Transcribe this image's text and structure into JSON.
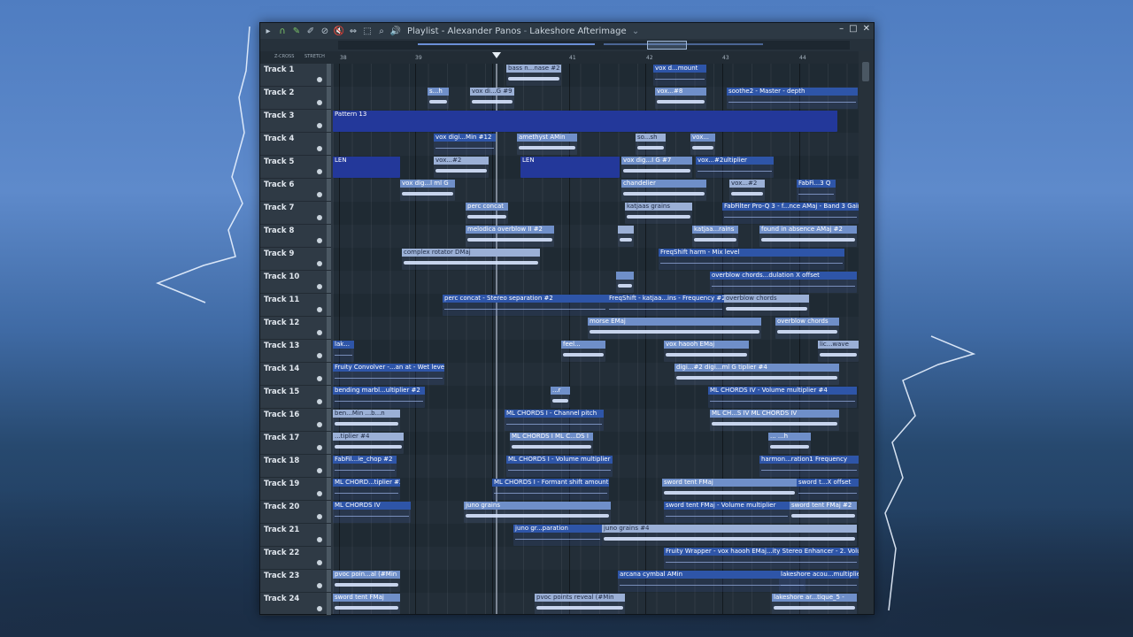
{
  "window": {
    "title_prefix": "Playlist",
    "title_sep": " - ",
    "artist": "Alexander Panos",
    "project": "Lakeshore Afterimage",
    "title_dash": "-",
    "dropdown_glyph": "⌄"
  },
  "toolbar": {
    "play": "▸",
    "magnet": "∩",
    "pencil": "✎",
    "brush": "✐",
    "delete": "⊘",
    "mute": "🔇",
    "slip": "⇔",
    "select": "⬚",
    "zoom": "⌕",
    "speaker": "🔊",
    "minimize": "–",
    "maximize": "□",
    "close": "✕"
  },
  "subtoolbar": {
    "zcross": "Z-CROSS",
    "stretch": "STRETCH"
  },
  "ruler": [
    "38",
    "39",
    "41",
    "42",
    "43",
    "44"
  ],
  "tracks": [
    "Track 1",
    "Track 2",
    "Track 3",
    "Track 4",
    "Track 5",
    "Track 6",
    "Track 7",
    "Track 8",
    "Track 9",
    "Track 10",
    "Track 11",
    "Track 12",
    "Track 13",
    "Track 14",
    "Track 15",
    "Track 16",
    "Track 17",
    "Track 18",
    "Track 19",
    "Track 20",
    "Track 21",
    "Track 22",
    "Track 23",
    "Track 24"
  ],
  "clips": [
    {
      "t": 0,
      "l": 196,
      "w": 62,
      "label": "bass n...nase #2",
      "k": "audio"
    },
    {
      "t": 0,
      "l": 362,
      "w": 60,
      "label": "vox d...mount",
      "k": "auto"
    },
    {
      "t": 1,
      "l": 107,
      "w": 24,
      "label": "s...h",
      "k": "audio"
    },
    {
      "t": 1,
      "l": 155,
      "w": 50,
      "label": "vox di...G #9",
      "k": "audio"
    },
    {
      "t": 1,
      "l": 364,
      "w": 58,
      "label": "vox...#8",
      "k": "audio"
    },
    {
      "t": 1,
      "l": 445,
      "w": 148,
      "label": "soothe2 - Master - depth",
      "k": "auto"
    },
    {
      "t": 2,
      "l": 0,
      "w": 570,
      "label": "Pattern 13",
      "k": "pattern"
    },
    {
      "t": 3,
      "l": 114,
      "w": 70,
      "label": "vox digi...Min #12",
      "k": "auto"
    },
    {
      "t": 3,
      "l": 208,
      "w": 68,
      "label": "amethyst AMin",
      "k": "audio"
    },
    {
      "t": 3,
      "l": 342,
      "w": 34,
      "label": "so...sh",
      "k": "audio"
    },
    {
      "t": 3,
      "l": 404,
      "w": 28,
      "label": "vox...",
      "k": "audio"
    },
    {
      "t": 4,
      "l": 0,
      "w": 76,
      "label": "LEN",
      "k": "pattern"
    },
    {
      "t": 4,
      "l": 114,
      "w": 62,
      "label": "vox...#2",
      "k": "audio"
    },
    {
      "t": 4,
      "l": 212,
      "w": 112,
      "label": "LEN",
      "k": "pattern"
    },
    {
      "t": 4,
      "l": 326,
      "w": 80,
      "label": "vox dig...I G #7",
      "k": "audio"
    },
    {
      "t": 4,
      "l": 410,
      "w": 88,
      "label": "vox...#2ultiplier",
      "k": "auto"
    },
    {
      "t": 5,
      "l": 76,
      "w": 62,
      "label": "vox dig...l ml G",
      "k": "audio"
    },
    {
      "t": 5,
      "l": 326,
      "w": 96,
      "label": "chandelier",
      "k": "audio"
    },
    {
      "t": 5,
      "l": 448,
      "w": 40,
      "label": "vox...#2",
      "k": "audio"
    },
    {
      "t": 5,
      "l": 524,
      "w": 44,
      "label": "FabFi...3 Q",
      "k": "auto"
    },
    {
      "t": 6,
      "l": 150,
      "w": 48,
      "label": "perc concat",
      "k": "audio"
    },
    {
      "t": 6,
      "l": 330,
      "w": 76,
      "label": "katjaas grains",
      "k": "audio"
    },
    {
      "t": 6,
      "l": 440,
      "w": 154,
      "label": "FabFilter Pro-Q 3 - f...nce AMaj - Band 3 Gain",
      "k": "auto"
    },
    {
      "t": 7,
      "l": 150,
      "w": 100,
      "label": "melodica overblow II #2",
      "k": "audio"
    },
    {
      "t": 7,
      "l": 322,
      "w": 18,
      "label": "",
      "k": "audio"
    },
    {
      "t": 7,
      "l": 406,
      "w": 52,
      "label": "katjaa...rains",
      "k": "audio"
    },
    {
      "t": 7,
      "l": 482,
      "w": 110,
      "label": "found in absence AMaj #2",
      "k": "audio"
    },
    {
      "t": 8,
      "l": 78,
      "w": 156,
      "label": "complex rotator DMaj",
      "k": "audio"
    },
    {
      "t": 8,
      "l": 368,
      "w": 210,
      "label": "FreqShift harm - Mix level",
      "k": "auto"
    },
    {
      "t": 9,
      "l": 320,
      "w": 20,
      "label": "",
      "k": "audio"
    },
    {
      "t": 9,
      "l": 426,
      "w": 166,
      "label": "overblow chords...dulation X offset",
      "k": "auto"
    },
    {
      "t": 10,
      "l": 124,
      "w": 186,
      "label": "perc concat - Stereo separation #2",
      "k": "auto"
    },
    {
      "t": 10,
      "l": 310,
      "w": 132,
      "label": "FreqShift - katjaa...ins - Frequency #2",
      "k": "auto"
    },
    {
      "t": 10,
      "l": 442,
      "w": 96,
      "label": "overblow chords",
      "k": "audio"
    },
    {
      "t": 11,
      "l": 288,
      "w": 196,
      "label": "morse EMaj",
      "k": "audio"
    },
    {
      "t": 11,
      "l": 500,
      "w": 72,
      "label": "overblow chords",
      "k": "audio"
    },
    {
      "t": 12,
      "l": 0,
      "w": 24,
      "label": "lak...",
      "k": "auto"
    },
    {
      "t": 12,
      "l": 258,
      "w": 50,
      "label": "feel...",
      "k": "audio"
    },
    {
      "t": 12,
      "l": 374,
      "w": 96,
      "label": "vox haooh EMaj",
      "k": "audio"
    },
    {
      "t": 12,
      "l": 548,
      "w": 46,
      "label": "lic...wave",
      "k": "audio"
    },
    {
      "t": 13,
      "l": 0,
      "w": 126,
      "label": "Fruity Convolver -...an at - Wet level",
      "k": "auto"
    },
    {
      "t": 13,
      "l": 386,
      "w": 186,
      "label": "digi...#2 digi...ml G tiplier #4",
      "k": "audio"
    },
    {
      "t": 14,
      "l": 0,
      "w": 104,
      "label": "bending marbl...ultiplier #2",
      "k": "auto"
    },
    {
      "t": 14,
      "l": 246,
      "w": 22,
      "label": "...r",
      "k": "audio"
    },
    {
      "t": 14,
      "l": 424,
      "w": 168,
      "label": "ML CHORDS IV - Volume multiplier #4",
      "k": "auto"
    },
    {
      "t": 15,
      "l": 0,
      "w": 76,
      "label": "ben...Min ...b...n",
      "k": "audio"
    },
    {
      "t": 15,
      "l": 194,
      "w": 112,
      "label": "ML CHORDS I - Channel pitch",
      "k": "auto"
    },
    {
      "t": 15,
      "l": 426,
      "w": 146,
      "label": "ML CH...S IV ML CHORDS IV",
      "k": "audio"
    },
    {
      "t": 16,
      "l": 0,
      "w": 80,
      "label": "...tiplier #4",
      "k": "audio"
    },
    {
      "t": 16,
      "l": 200,
      "w": 94,
      "label": "ML CHORDS I ML C...DS I",
      "k": "audio"
    },
    {
      "t": 16,
      "l": 492,
      "w": 48,
      "label": "...  ...h",
      "k": "audio"
    },
    {
      "t": 17,
      "l": 0,
      "w": 72,
      "label": "FabFil...ie_chop #2",
      "k": "auto"
    },
    {
      "t": 17,
      "l": 196,
      "w": 120,
      "label": "ML CHORDS I - Volume multiplier",
      "k": "auto"
    },
    {
      "t": 17,
      "l": 482,
      "w": 112,
      "label": "harmon...ration1 Frequency",
      "k": "auto"
    },
    {
      "t": 18,
      "l": 0,
      "w": 76,
      "label": "ML CHORD...tiplier #2",
      "k": "auto"
    },
    {
      "t": 18,
      "l": 180,
      "w": 132,
      "label": "ML CHORDS I - Formant shift amount",
      "k": "auto"
    },
    {
      "t": 18,
      "l": 372,
      "w": 152,
      "label": "sword tent FMaj",
      "k": "audio"
    },
    {
      "t": 18,
      "l": 524,
      "w": 70,
      "label": "sword t...X offset",
      "k": "auto"
    },
    {
      "t": 19,
      "l": 0,
      "w": 88,
      "label": "ML CHORDS IV",
      "k": "auto"
    },
    {
      "t": 19,
      "l": 148,
      "w": 166,
      "label": "juno grains",
      "k": "audio"
    },
    {
      "t": 19,
      "l": 374,
      "w": 142,
      "label": "sword tent FMaj - Volume multiplier",
      "k": "auto"
    },
    {
      "t": 19,
      "l": 516,
      "w": 76,
      "label": "sword tent FMaj #2",
      "k": "audio"
    },
    {
      "t": 20,
      "l": 204,
      "w": 100,
      "label": "juno gr...paration",
      "k": "auto"
    },
    {
      "t": 20,
      "l": 304,
      "w": 288,
      "label": "juno grains #4",
      "k": "audio"
    },
    {
      "t": 21,
      "l": 374,
      "w": 220,
      "label": "Fruity Wrapper - vox haooh EMaj...ity Stereo Enhancer - 2. Volume",
      "k": "auto"
    },
    {
      "t": 22,
      "l": 0,
      "w": 76,
      "label": "pvoc poin...al (#Min",
      "k": "audio"
    },
    {
      "t": 22,
      "l": 322,
      "w": 212,
      "label": "arcana cymbal AMin",
      "k": "auto"
    },
    {
      "t": 22,
      "l": 504,
      "w": 90,
      "label": "lakeshore acou...multiplier",
      "k": "auto"
    },
    {
      "t": 23,
      "l": 0,
      "w": 76,
      "label": "sword tent FMaj",
      "k": "audio"
    },
    {
      "t": 23,
      "l": 228,
      "w": 102,
      "label": "pvoc points reveal (#Min",
      "k": "audio"
    },
    {
      "t": 23,
      "l": 496,
      "w": 96,
      "label": "lakeshore ar...tique_5 -",
      "k": "audio"
    }
  ]
}
